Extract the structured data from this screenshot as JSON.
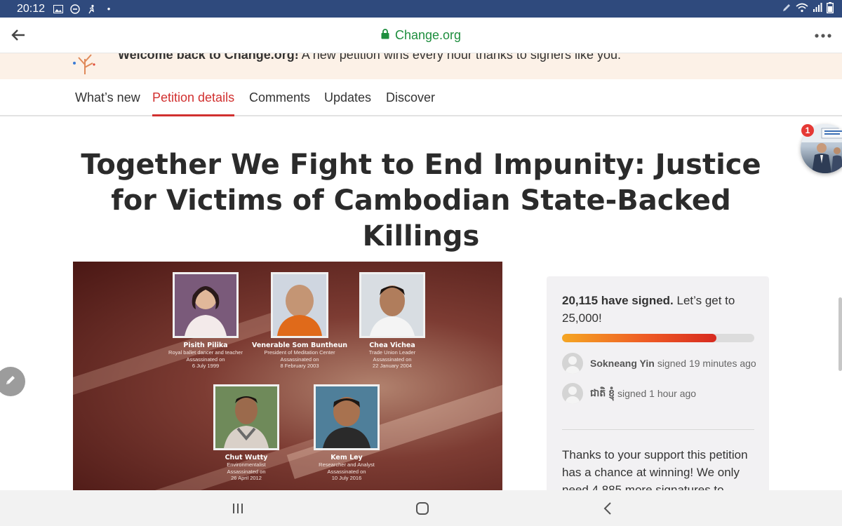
{
  "status_bar": {
    "time": "20:12",
    "icons_left": [
      "gallery-icon",
      "do-not-disturb-icon",
      "activity-icon",
      "dot-icon"
    ],
    "icons_right": [
      "pen-icon",
      "wifi-icon",
      "signal-icon",
      "battery-icon"
    ]
  },
  "browser": {
    "url": "Change.org",
    "secure": true
  },
  "welcome": {
    "bold": "Welcome back to Change.org!",
    "text": "A new petition wins every hour thanks to signers like you."
  },
  "tabs": [
    {
      "label": "What’s new",
      "active": false
    },
    {
      "label": "Petition details",
      "active": true
    },
    {
      "label": "Comments",
      "active": false
    },
    {
      "label": "Updates",
      "active": false
    },
    {
      "label": "Discover",
      "active": false
    }
  ],
  "petition": {
    "title": "Together We Fight to End Impunity: Justice for Victims of Cambodian State-Backed Killings"
  },
  "notification": {
    "badge": "1"
  },
  "victims": [
    {
      "name": "Pisith Pilika",
      "line1": "Royal ballet dancer and teacher",
      "line2": "Assassinated on",
      "line3": "6 July 1999"
    },
    {
      "name": "Venerable Som Buntheun",
      "line1": "President of Meditation Center",
      "line2": "Assassinated on",
      "line3": "8 February 2003"
    },
    {
      "name": "Chea Vichea",
      "line1": "Trade Union Leader",
      "line2": "Assassinated on",
      "line3": "22 January 2004"
    },
    {
      "name": "Chut Wutty",
      "line1": "Environmentalist",
      "line2": "Assassinated on",
      "line3": "26 April 2012"
    },
    {
      "name": "Kem Ley",
      "line1": "Researcher and Analyst",
      "line2": "Assassinated on",
      "line3": "10 July 2016"
    }
  ],
  "signatures": {
    "count_text": "20,115 have signed.",
    "goal_text": "Let’s get to 25,000!",
    "progress_fraction": 0.8046,
    "recent": [
      {
        "name": "Sokneang Yin",
        "action": "signed 19 minutes ago"
      },
      {
        "name": "ជាតិ ខ្ញុំ",
        "action": "signed 1 hour ago"
      }
    ],
    "support_text": "Thanks to your support this petition has a chance at winning! We only need 4,885 more signatures to"
  },
  "colors": {
    "status_bar": "#2f4a7d",
    "secure_green": "#1e8e3e",
    "accent_red": "#d1302f",
    "progress_start": "#f5a623",
    "progress_end": "#d72a1f"
  }
}
